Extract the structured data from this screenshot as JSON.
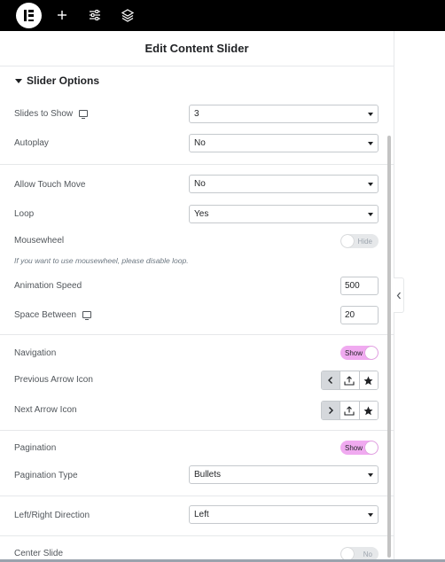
{
  "topbar": {
    "icons": [
      "elementor-logo-icon",
      "add-icon",
      "sliders-icon",
      "layers-icon"
    ]
  },
  "panel": {
    "title": "Edit Content Slider",
    "section_title": "Slider Options"
  },
  "fields": {
    "slides_to_show": {
      "label": "Slides to Show",
      "value": "3"
    },
    "autoplay": {
      "label": "Autoplay",
      "value": "No"
    },
    "allow_touch_move": {
      "label": "Allow Touch Move",
      "value": "No"
    },
    "loop": {
      "label": "Loop",
      "value": "Yes"
    },
    "mousewheel": {
      "label": "Mousewheel",
      "toggle": "Hide",
      "note": "If you want to use mousewheel, please disable loop."
    },
    "animation_speed": {
      "label": "Animation Speed",
      "value": "500"
    },
    "space_between": {
      "label": "Space Between",
      "value": "20"
    },
    "navigation": {
      "label": "Navigation",
      "toggle": "Show"
    },
    "previous_arrow_icon": {
      "label": "Previous Arrow Icon"
    },
    "next_arrow_icon": {
      "label": "Next Arrow Icon"
    },
    "pagination": {
      "label": "Pagination",
      "toggle": "Show"
    },
    "pagination_type": {
      "label": "Pagination Type",
      "value": "Bullets"
    },
    "left_right_direction": {
      "label": "Left/Right Direction",
      "value": "Left"
    },
    "center_slide": {
      "label": "Center Slide",
      "toggle": "No"
    }
  },
  "colors": {
    "topbar": "#000000",
    "toggle_on": "#f0aaf0",
    "toggle_off": "#e6e8ea",
    "border": "#c5c9cd"
  }
}
